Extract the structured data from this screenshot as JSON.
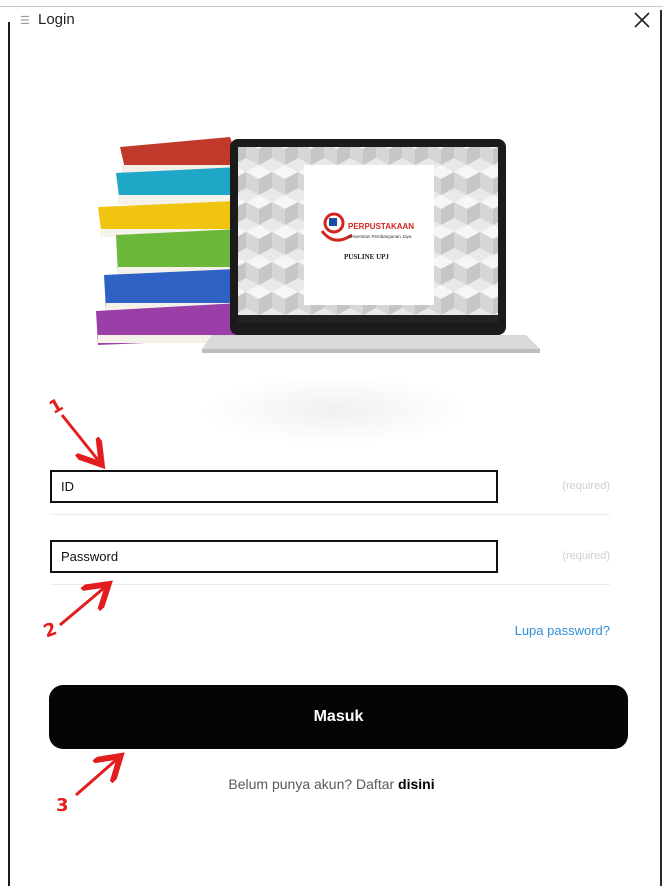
{
  "window": {
    "title": "Login",
    "menu_icon": "menu-icon",
    "close_icon": "close-icon"
  },
  "illustration": {
    "brand_name": "PERPUSTAKAAN",
    "brand_sub": "Universitas Pembangunan Jaya",
    "app_name": "PUSLINE UPJ"
  },
  "form": {
    "id_field": {
      "value": "ID",
      "hint": "(required)"
    },
    "password_field": {
      "value": "Password",
      "hint": "(required)"
    },
    "forgot_link": "Lupa password?",
    "submit_label": "Masuk",
    "signup_text": "Belum punya akun? Daftar",
    "signup_link": "disini"
  },
  "annotations": [
    {
      "label": "1"
    },
    {
      "label": "2"
    },
    {
      "label": "3"
    }
  ],
  "colors": {
    "annotation": "#e31d1d",
    "link": "#2f8fd8",
    "button": "#050505"
  }
}
